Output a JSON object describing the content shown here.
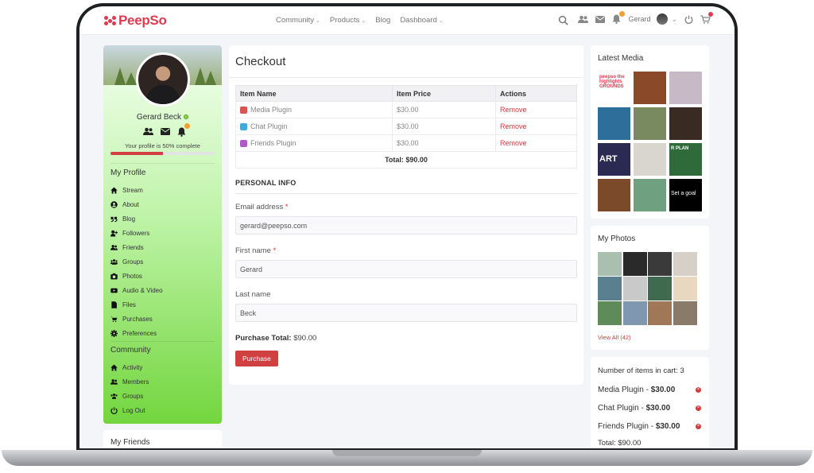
{
  "header": {
    "logo_text": "PeepSo",
    "nav": [
      {
        "label": "Community",
        "dropdown": true
      },
      {
        "label": "Products",
        "dropdown": true
      },
      {
        "label": "Blog",
        "dropdown": false
      },
      {
        "label": "Dashboard",
        "dropdown": true
      }
    ],
    "user_name": "Gerard",
    "icons": [
      "search-icon",
      "members-icon",
      "messages-icon",
      "notifications-icon",
      "chevron-down-icon",
      "power-icon",
      "cart-icon"
    ]
  },
  "profile": {
    "name": "Gerard Beck",
    "completion_text": "Your profile is 50% complete",
    "completion_fraction": 0.5
  },
  "my_profile": {
    "title": "My Profile",
    "items": [
      {
        "label": "Stream",
        "icon": "home-icon"
      },
      {
        "label": "About",
        "icon": "user-circle-icon"
      },
      {
        "label": "Blog",
        "icon": "quote-icon"
      },
      {
        "label": "Followers",
        "icon": "user-plus-icon"
      },
      {
        "label": "Friends",
        "icon": "users-icon"
      },
      {
        "label": "Groups",
        "icon": "group-icon"
      },
      {
        "label": "Photos",
        "icon": "camera-icon"
      },
      {
        "label": "Audio & Video",
        "icon": "video-icon"
      },
      {
        "label": "Files",
        "icon": "file-icon"
      },
      {
        "label": "Purchases",
        "icon": "cart-icon"
      },
      {
        "label": "Preferences",
        "icon": "gear-icon"
      }
    ]
  },
  "community": {
    "title": "Community",
    "items": [
      {
        "label": "Activity",
        "icon": "home-icon"
      },
      {
        "label": "Members",
        "icon": "users-icon"
      },
      {
        "label": "Groups",
        "icon": "group-icon"
      },
      {
        "label": "Log Out",
        "icon": "power-icon"
      }
    ]
  },
  "my_friends": {
    "title": "My Friends"
  },
  "checkout": {
    "title": "Checkout",
    "columns": [
      "Item Name",
      "Item Price",
      "Actions"
    ],
    "items": [
      {
        "name": "Media Plugin",
        "price": "$30.00",
        "action": "Remove",
        "icon_color": "#d9534f"
      },
      {
        "name": "Chat Plugin",
        "price": "$30.00",
        "action": "Remove",
        "icon_color": "#3fa9e0"
      },
      {
        "name": "Friends Plugin",
        "price": "$30.00",
        "action": "Remove",
        "icon_color": "#b05cc8"
      }
    ],
    "total": "Total: $90.00",
    "personal_info": "PERSONAL INFO",
    "fields": [
      {
        "label": "Email address",
        "required": "*",
        "value": "gerard@peepso.com"
      },
      {
        "label": "First name",
        "required": "*",
        "value": "Gerard"
      },
      {
        "label": "Last name",
        "required": "",
        "value": "Beck"
      }
    ],
    "purchase_total_label": "Purchase Total:",
    "purchase_total_value": "$90.00",
    "purchase_button": "Purchase"
  },
  "latest_media": {
    "title": "Latest Media",
    "tiles": [
      {
        "text": "peepso the highlights GROUNDS",
        "color": "#ffffff",
        "fg": "#e2394f"
      },
      {
        "text": "",
        "color": "#8a4a2a",
        "fg": "#fff"
      },
      {
        "text": "",
        "color": "#c7b9c6",
        "fg": "#fff"
      },
      {
        "text": "",
        "color": "#2d6f9a",
        "fg": "#fff"
      },
      {
        "text": "",
        "color": "#7a8a60",
        "fg": "#fff"
      },
      {
        "text": "",
        "color": "#3a2a24",
        "fg": "#fff"
      },
      {
        "text": "ART",
        "color": "#2a2a52",
        "fg": "#ffffff"
      },
      {
        "text": "",
        "color": "#d9d5cf",
        "fg": "#fff"
      },
      {
        "text": "R PLAN",
        "color": "#2f6a3a",
        "fg": "#ffffff"
      },
      {
        "text": "",
        "color": "#7a4a2a",
        "fg": "#fff"
      },
      {
        "text": "",
        "color": "#6fa080",
        "fg": "#fff"
      },
      {
        "text": "Set a goal",
        "color": "#000000",
        "fg": "#ffffff"
      }
    ]
  },
  "my_photos": {
    "title": "My Photos",
    "view_all": "View All (42)",
    "tiles": [
      "#a9c0b0",
      "#2a2a2a",
      "#3a3a3a",
      "#d6d0c8",
      "#5a8090",
      "#c9c9c9",
      "#3f6a4f",
      "#e8d8c0",
      "#5f8a5a",
      "#7f98b0",
      "#a07858",
      "#8a7a6a"
    ]
  },
  "cart": {
    "count_text": "Number of items in cart: 3",
    "items": [
      {
        "name": "Media Plugin -",
        "price": "$30.00"
      },
      {
        "name": "Chat Plugin -",
        "price": "$30.00"
      },
      {
        "name": "Friends Plugin -",
        "price": "$30.00"
      }
    ],
    "total_text": "Total: $90.00"
  },
  "colors": {
    "accent": "#d04040",
    "brand": "#e2394f",
    "sidebar_green": "#73d63e"
  }
}
